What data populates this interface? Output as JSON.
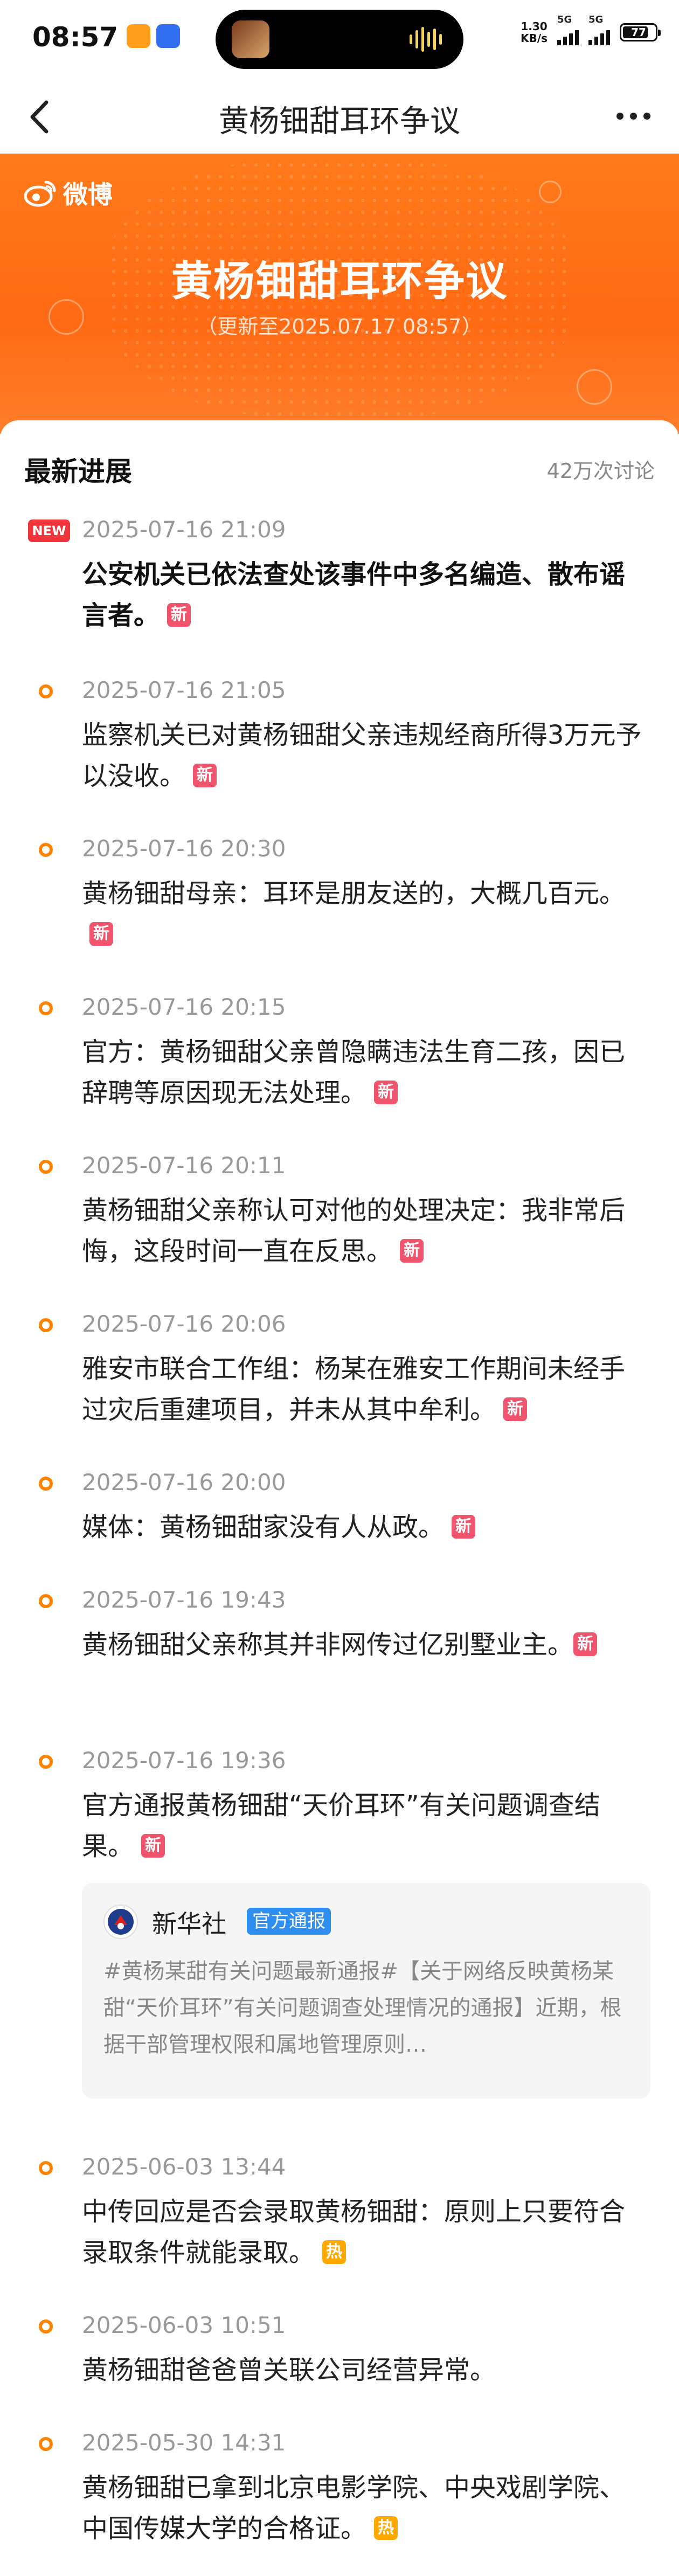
{
  "status_bar": {
    "time": "08:57",
    "net_speed_value": "1.30",
    "net_speed_unit": "KB/s",
    "signal1": "5G",
    "signal2": "5G",
    "battery": "77"
  },
  "nav": {
    "title": "黄杨钿甜耳环争议"
  },
  "banner": {
    "brand": "微博",
    "title": "黄杨钿甜耳环争议",
    "subtitle": "（更新至2025.07.17 08:57）"
  },
  "card": {
    "title": "最新进展",
    "count": "42万次讨论"
  },
  "entries": [
    {
      "time": "2025-07-16 21:09",
      "text": "公安机关已依法查处该事件中多名编造、散布谣言者。",
      "tag": "新"
    },
    {
      "time": "2025-07-16 21:05",
      "text": "监察机关已对黄杨钿甜父亲违规经商所得3万元予以没收。",
      "tag": "新"
    },
    {
      "time": "2025-07-16 20:30",
      "text": "黄杨钿甜母亲：耳环是朋友送的，大概几百元。",
      "tag": "新"
    },
    {
      "time": "2025-07-16 20:15",
      "text": "官方：黄杨钿甜父亲曾隐瞒违法生育二孩，因已辞聘等原因现无法处理。",
      "tag": "新"
    },
    {
      "time": "2025-07-16 20:11",
      "text": "黄杨钿甜父亲称认可对他的处理决定：我非常后悔，这段时间一直在反思。",
      "tag": "新"
    },
    {
      "time": "2025-07-16 20:06",
      "text": "雅安市联合工作组：杨某在雅安工作期间未经手过灾后重建项目，并未从其中牟利。",
      "tag": "新"
    },
    {
      "time": "2025-07-16 20:00",
      "text": "媒体：黄杨钿甜家没有人从政。",
      "tag": "新"
    },
    {
      "time": "2025-07-16 19:43",
      "text": "黄杨钿甜父亲称其并非网传过亿别墅业主。",
      "tag": "新"
    },
    {
      "time": "2025-07-16 19:36",
      "text": "官方通报黄杨钿甜“天价耳环”有关问题调查结果。",
      "tag": "新"
    },
    {
      "time": "2025-06-03 13:44",
      "text": "中传回应是否会录取黄杨钿甜：原则上只要符合录取条件就能录取。",
      "tag": "热"
    },
    {
      "time": "2025-06-03 10:51",
      "text": "黄杨钿甜爸爸曾关联公司经营异常。",
      "tag": ""
    },
    {
      "time": "2025-05-30 14:31",
      "text": "黄杨钿甜已拿到北京电影学院、中央戏剧学院、中国传媒大学的合格证。",
      "tag": "热"
    }
  ],
  "first_badge": "NEW",
  "quote": {
    "source": "新华社",
    "badge": "官方通报",
    "body": "#黄杨某甜有关问题最新通报#【关于网络反映黄杨某甜“天价耳环”有关问题调查处理情况的通报】近期，根据干部管理权限和属地管理原则…"
  }
}
